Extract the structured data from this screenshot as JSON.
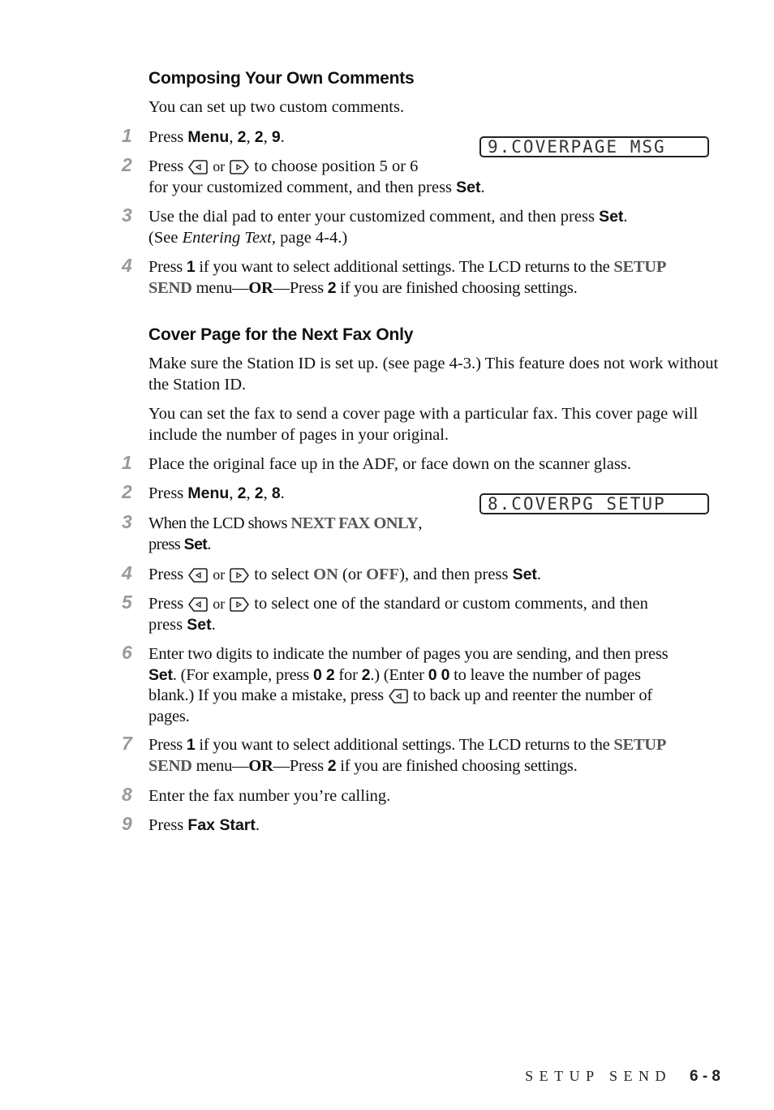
{
  "section1": {
    "heading": "Composing Your Own Comments",
    "intro": "You can set up two custom comments.",
    "lcd": "9.COVERPAGE MSG",
    "steps": [
      {
        "num": "1",
        "t1": "Press ",
        "b1": "Menu",
        "t2": ", ",
        "b2": "2",
        "t3": ", ",
        "b3": "2",
        "t4": ", ",
        "b4": "9",
        "t5": "."
      },
      {
        "num": "2",
        "t1": "Press",
        "or": "or",
        "t2": "to choose position 5 or 6",
        "t3": "for your customized comment, and then press ",
        "b1": "Set",
        "t4": "."
      },
      {
        "num": "3",
        "t1": "Use the dial pad to enter your customized comment, and then press ",
        "b1": "Set",
        "t2": ".",
        "t3": "(See ",
        "i1": "Entering Text",
        "t4": ", page 4-4.)"
      },
      {
        "num": "4",
        "t1": "Press ",
        "b1": "1",
        "t2": " if you want to select additional settings. The LCD returns to the ",
        "l1": "SETUP",
        "l2": "SEND",
        "t3": " menu—",
        "or": "OR",
        "t4": "—Press ",
        "b2": "2",
        "t5": " if you are finished choosing settings."
      }
    ]
  },
  "section2": {
    "heading": "Cover Page for the Next Fax Only",
    "para1": "Make sure the Station ID is set up. (see page 4-3.) This feature does not work without the Station ID.",
    "para2": "You can set the fax to send a cover page with a particular fax. This cover page will include the number of pages in your original.",
    "lcd": "8.COVERPG SETUP",
    "steps": [
      {
        "num": "1",
        "t1": "Place the original face up in the ADF, or face down on the scanner glass."
      },
      {
        "num": "2",
        "t1": "Press ",
        "b1": "Menu",
        "t2": ", ",
        "b2": "2",
        "t3": ", ",
        "b3": "2",
        "t4": ", ",
        "b4": "8",
        "t5": "."
      },
      {
        "num": "3",
        "t1": "When the LCD shows ",
        "l1": "NEXT FAX ONLY",
        "t2": ",",
        "t3": "press ",
        "b1": "Set",
        "t4": "."
      },
      {
        "num": "4",
        "t1": "Press",
        "or": "or",
        "t2": "to select ",
        "l1": "ON",
        "t3": " (or ",
        "l2": "OFF",
        "t4": "), and then press ",
        "b1": "Set",
        "t5": "."
      },
      {
        "num": "5",
        "t1": "Press",
        "or": "or",
        "t2": "to select one of the standard or custom comments, and then",
        "t3": "press ",
        "b1": "Set",
        "t4": "."
      },
      {
        "num": "6",
        "t1": "Enter two digits to indicate the number of pages you are sending, and then press",
        "b1": "Set",
        "t2": ". (For example, press ",
        "b2": "0 2",
        "t3": " for ",
        "b3": "2",
        "t4": ".) (Enter ",
        "b4": "0 0",
        "t5": " to leave the number of pages",
        "t6": "blank.) If you make a mistake, press",
        "t7": "to back up and reenter the number of",
        "t8": "pages."
      },
      {
        "num": "7",
        "t1": "Press ",
        "b1": "1",
        "t2": " if you want to select additional settings. The LCD returns to the ",
        "l1": "SETUP",
        "l2": "SEND",
        "t3": " menu—",
        "or": "OR",
        "t4": "—Press ",
        "b2": "2",
        "t5": " if you are finished choosing settings."
      },
      {
        "num": "8",
        "t1": "Enter the fax number you’re calling."
      },
      {
        "num": "9",
        "t1": "Press ",
        "b1": "Fax Start",
        "t2": "."
      }
    ]
  },
  "footer": {
    "section": "SETUP SEND",
    "page": "6 - 8"
  },
  "icons": {
    "left_arrow_key": "left-arrow-key-icon",
    "right_arrow_key": "right-arrow-key-icon"
  }
}
